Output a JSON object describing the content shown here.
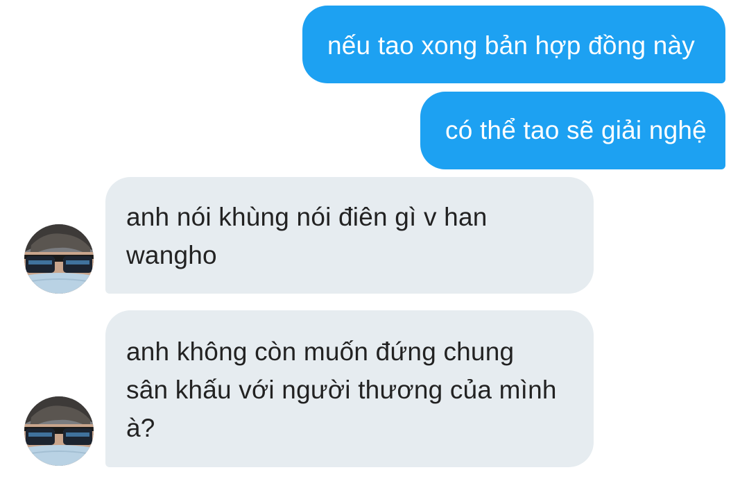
{
  "messages": [
    {
      "direction": "outgoing",
      "lines": [
        "nếu tao xong bản hợp đồng này"
      ]
    },
    {
      "direction": "outgoing",
      "lines": [
        "có thể tao sẽ giải nghệ"
      ]
    },
    {
      "direction": "incoming",
      "lines": [
        "anh nói khùng nói điên gì v han",
        "wangho"
      ]
    },
    {
      "direction": "incoming",
      "lines": [
        "anh không còn muốn đứng chung",
        "sân khấu với người thương của mình",
        "à?"
      ]
    }
  ],
  "colors": {
    "outgoing_bubble": "#1da1f2",
    "incoming_bubble": "#e6ecf0",
    "outgoing_text": "#ffffff",
    "incoming_text": "#222222"
  },
  "icons": {
    "avatar": "user-avatar-sunglasses-mask"
  }
}
